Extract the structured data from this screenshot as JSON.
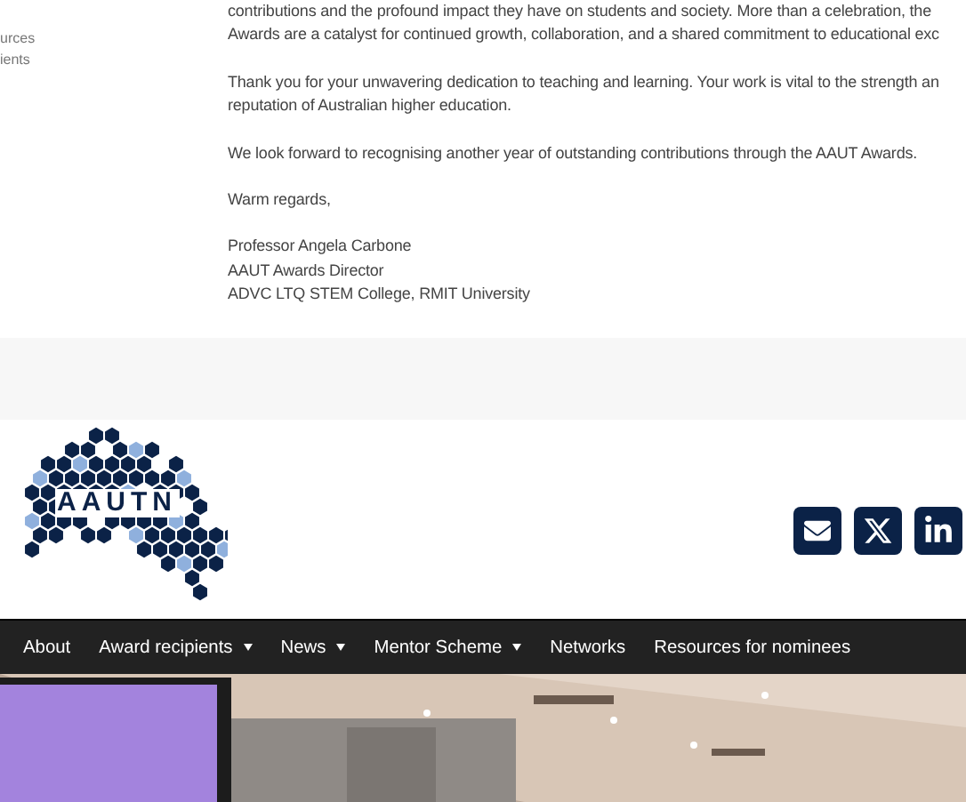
{
  "sidebar": {
    "items": [
      "urces",
      "ients"
    ]
  },
  "letter": {
    "paragraphs": [
      [
        "contributions and the profound impact they have on students and society. More than a celebration, the",
        "Awards are a catalyst for continued growth, collaboration, and a shared commitment to educational exc"
      ],
      [
        "Thank you for your unwavering dedication to teaching and learning. Your work is vital to the strength an",
        "reputation of Australian higher education."
      ],
      [
        "We look forward to recognising another year of outstanding contributions through the AAUT Awards."
      ],
      [
        "Warm regards,"
      ],
      [
        "Professor Angela Carbone",
        "AAUT Awards Director",
        "ADVC LTQ STEM College, RMIT University"
      ]
    ]
  },
  "header": {
    "logo_text": "AAUTN",
    "social": [
      {
        "kind": "email"
      },
      {
        "kind": "x"
      },
      {
        "kind": "linkedin"
      }
    ]
  },
  "nav": {
    "items": [
      {
        "label": "About",
        "dropdown": false
      },
      {
        "label": "Award recipients",
        "dropdown": true
      },
      {
        "label": "News",
        "dropdown": true
      },
      {
        "label": "Mentor Scheme",
        "dropdown": true
      },
      {
        "label": "Networks",
        "dropdown": false
      },
      {
        "label": "Resources for nominees",
        "dropdown": false
      }
    ]
  }
}
